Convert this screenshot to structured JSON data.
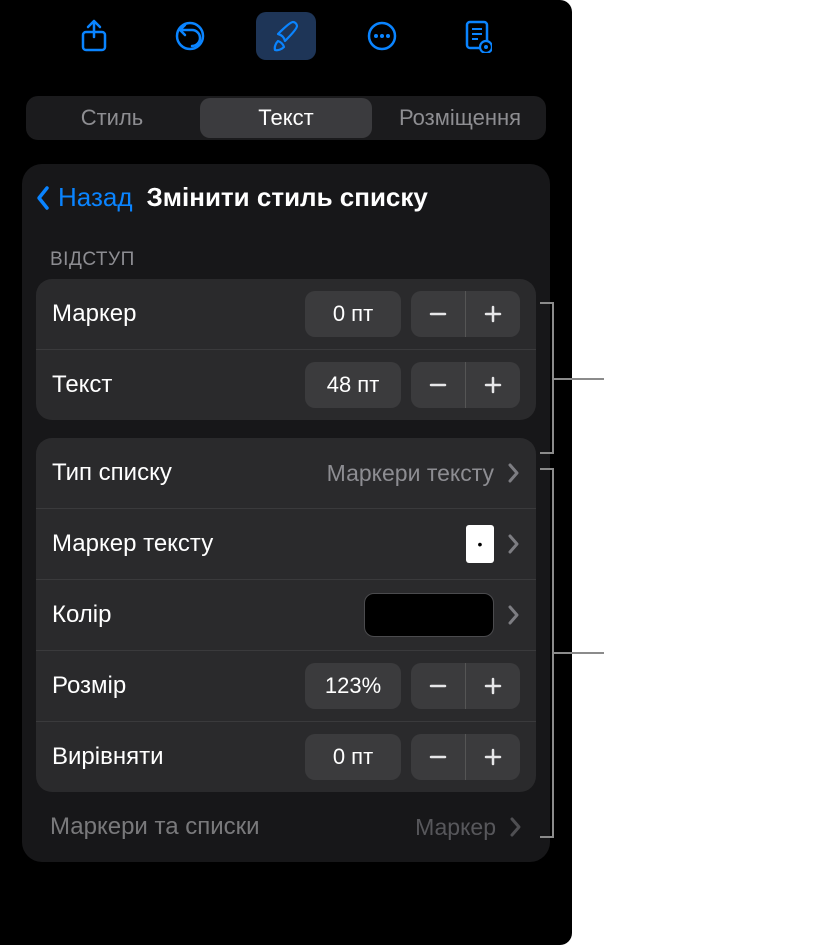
{
  "toolbar": {
    "icons": [
      "share-icon",
      "undo-icon",
      "brush-icon",
      "more-icon",
      "document-icon"
    ],
    "active_index": 2
  },
  "segmented": {
    "items": [
      "Стиль",
      "Текст",
      "Розміщення"
    ],
    "selected_index": 1
  },
  "nav": {
    "back": "Назад",
    "title": "Змінити стиль списку"
  },
  "indent": {
    "header": "ВІДСТУП",
    "marker": {
      "label": "Маркер",
      "value": "0 пт"
    },
    "text": {
      "label": "Текст",
      "value": "48 пт"
    }
  },
  "list": {
    "type": {
      "label": "Тип списку",
      "value": "Маркери тексту"
    },
    "marker": {
      "label": "Маркер тексту",
      "glyph": "•"
    },
    "color": {
      "label": "Колір",
      "swatch": "#000000"
    },
    "size": {
      "label": "Розмір",
      "value": "123%"
    },
    "align": {
      "label": "Вирівняти",
      "value": "0 пт"
    }
  },
  "footer": {
    "label": "Маркери та списки",
    "value": "Маркер"
  },
  "glyphs": {
    "minus": "−",
    "plus": "+"
  }
}
